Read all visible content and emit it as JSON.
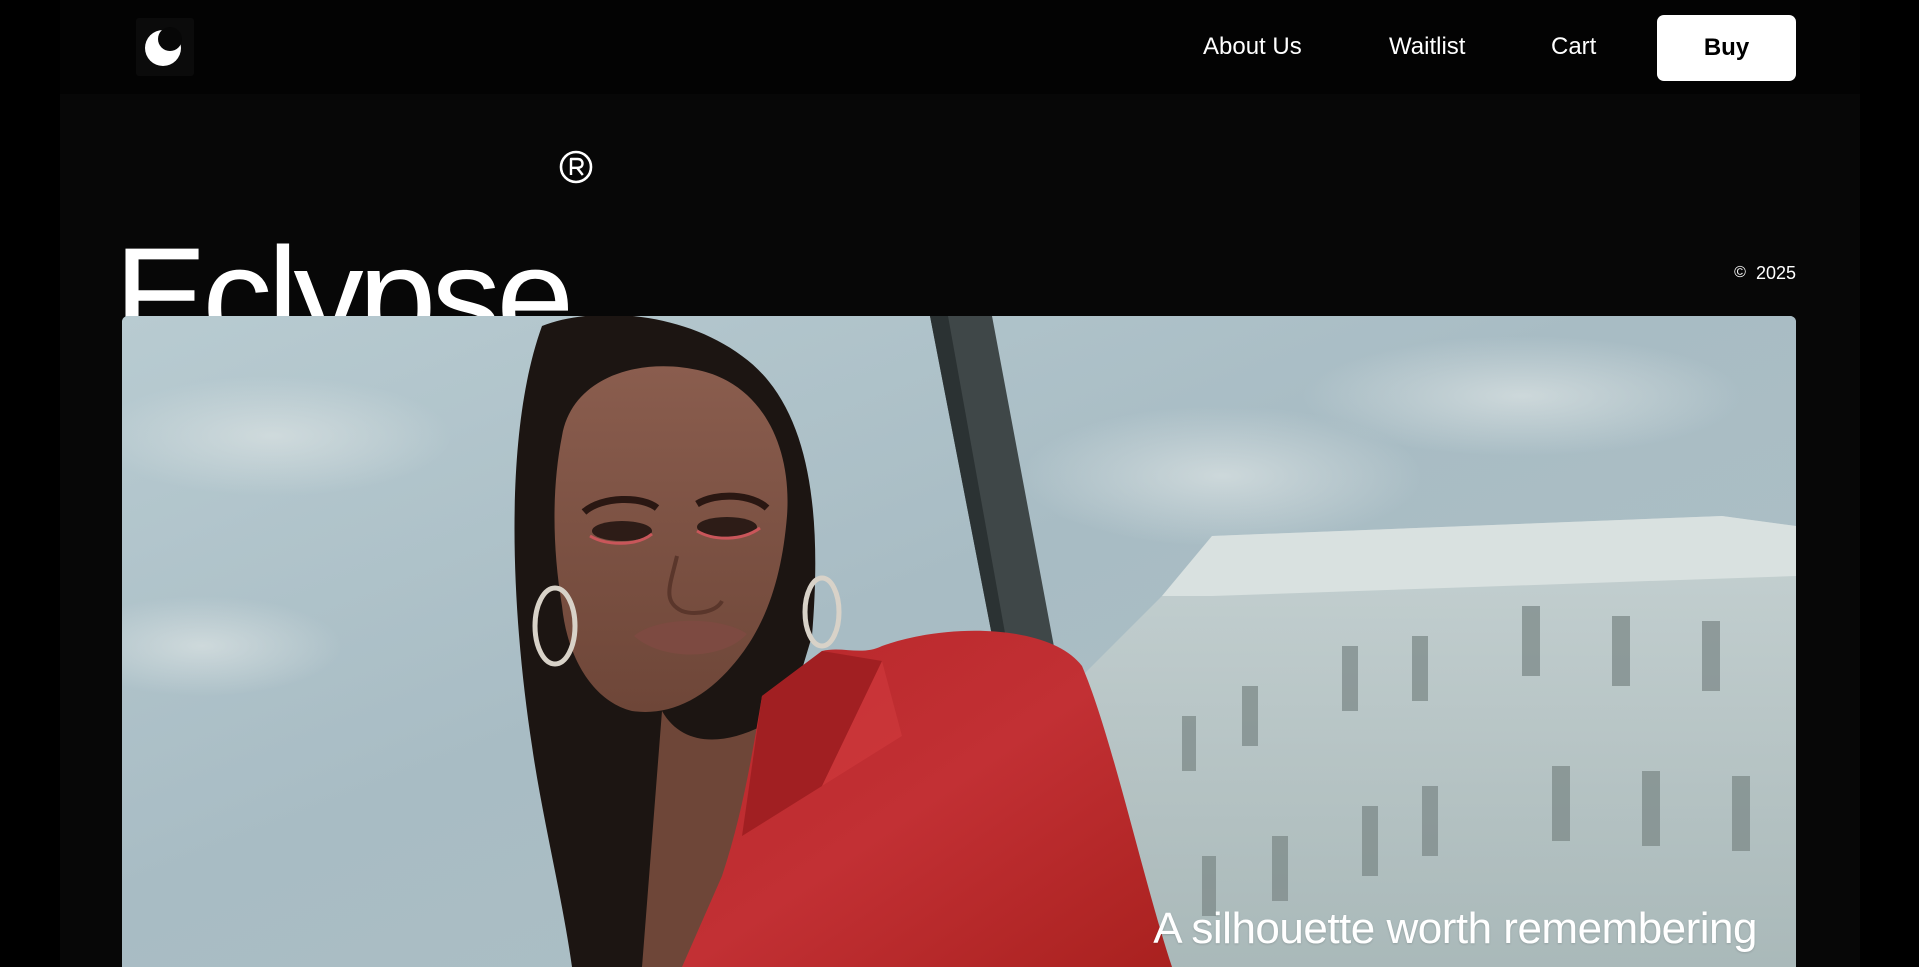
{
  "nav": {
    "logo_icon": "eclipse-logo-icon",
    "links": [
      "About Us",
      "Waitlist",
      "Cart"
    ],
    "buy_label": "Buy"
  },
  "hero": {
    "brand": "Eclypse",
    "registered_icon": "registered-trademark-icon",
    "copyright_symbol": "©",
    "year": "2025",
    "tagline": "A silhouette worth remembering",
    "image_icon": "model-in-red-jacket-photo"
  },
  "colors": {
    "background": "#070707",
    "navbar": "#030303",
    "button_bg": "#ffffff",
    "button_text": "#000000",
    "text": "#ffffff"
  }
}
